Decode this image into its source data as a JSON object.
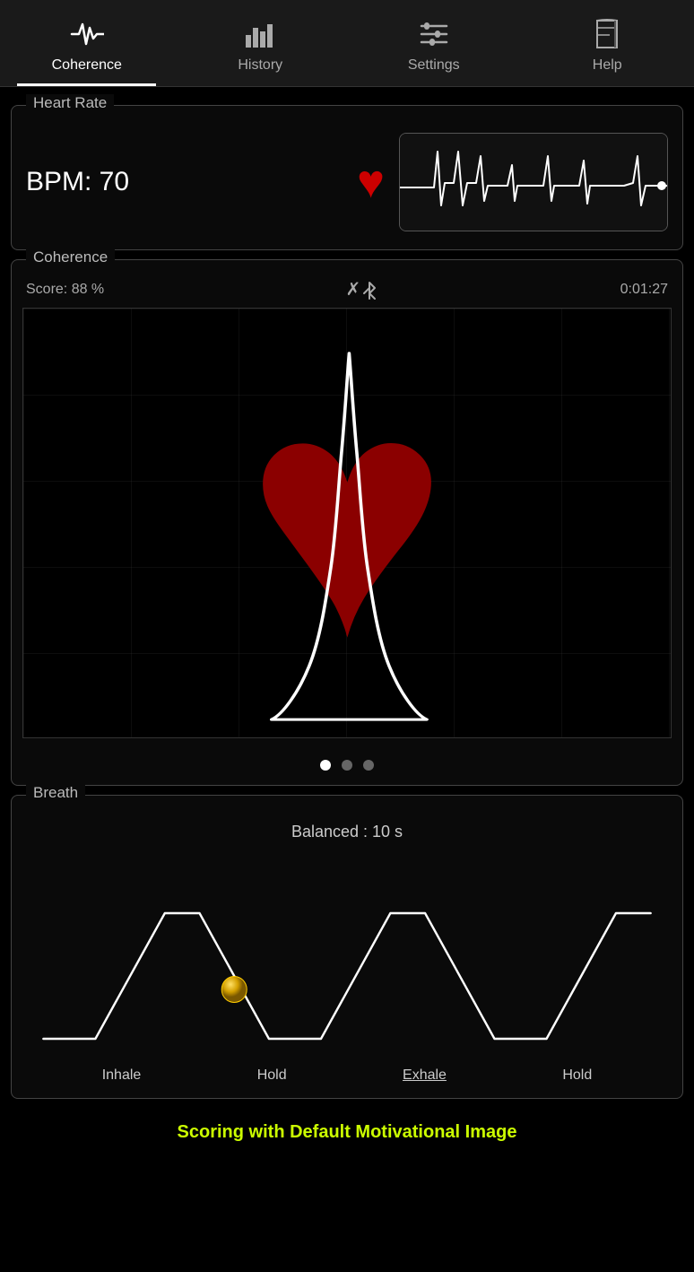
{
  "tabs": [
    {
      "id": "coherence",
      "label": "Coherence",
      "icon": "pulse",
      "active": true
    },
    {
      "id": "history",
      "label": "History",
      "icon": "bar-chart",
      "active": false
    },
    {
      "id": "settings",
      "label": "Settings",
      "icon": "sliders",
      "active": false
    },
    {
      "id": "help",
      "label": "Help",
      "icon": "book",
      "active": false
    }
  ],
  "heart_rate": {
    "section_title": "Heart Rate",
    "bpm_label": "BPM: 70"
  },
  "coherence": {
    "section_title": "Coherence",
    "score_label": "Score: 88 %",
    "timer_label": "0:01:27"
  },
  "breath": {
    "section_title": "Breath",
    "mode_label": "Balanced : 10 s",
    "phase_labels": [
      "Inhale",
      "Hold",
      "Exhale",
      "Hold"
    ]
  },
  "status_bar": {
    "message": "Scoring with Default Motivational Image"
  },
  "dots": [
    {
      "active": true
    },
    {
      "active": false
    },
    {
      "active": false
    }
  ]
}
